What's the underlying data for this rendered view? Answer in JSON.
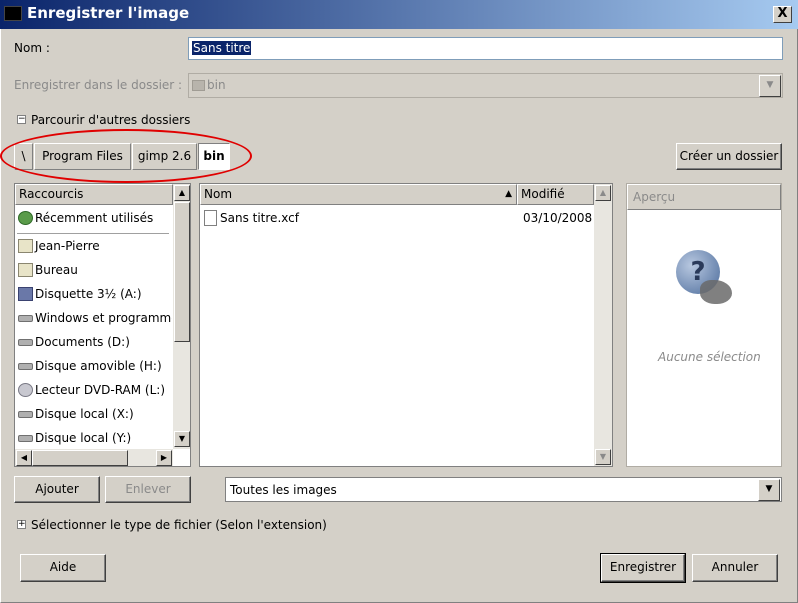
{
  "window": {
    "title": "Enregistrer l'image",
    "close_glyph": "X"
  },
  "name_field": {
    "label": "Nom :",
    "value": "Sans titre"
  },
  "save_in": {
    "label": "Enregistrer dans le dossier :",
    "value": "bin"
  },
  "browse": {
    "label": "Parcourir d'autres dossiers",
    "toggle": "−"
  },
  "path": {
    "buttons": [
      "\\",
      "Program Files",
      "gimp 2.6",
      "bin"
    ],
    "create_folder": "Créer un dossier"
  },
  "places": {
    "header": "Raccourcis",
    "items": [
      {
        "label": "Récemment utilisés",
        "icon": "recent-icon"
      },
      {
        "label": "Jean-Pierre",
        "icon": "folder-icon"
      },
      {
        "label": "Bureau",
        "icon": "folder-icon"
      },
      {
        "label": "Disquette 3½ (A:)",
        "icon": "floppy-icon"
      },
      {
        "label": "Windows et programmes (C:)",
        "icon": "drive-icon"
      },
      {
        "label": "Documents (D:)",
        "icon": "drive-icon"
      },
      {
        "label": "Disque amovible (H:)",
        "icon": "drive-icon"
      },
      {
        "label": "Lecteur DVD-RAM (L:)",
        "icon": "cdrom-icon"
      },
      {
        "label": "Disque local (X:)",
        "icon": "drive-icon"
      },
      {
        "label": "Disque local (Y:)",
        "icon": "drive-icon"
      }
    ],
    "add_label": "Ajouter",
    "remove_label": "Enlever"
  },
  "files": {
    "col_name": "Nom",
    "col_modified": "Modifié",
    "rows": [
      {
        "name": "Sans titre.xcf",
        "modified": "03/10/2008"
      }
    ]
  },
  "preview": {
    "header": "Aperçu",
    "empty": "Aucune sélection"
  },
  "filter": {
    "value": "Toutes les images"
  },
  "filetype": {
    "label": "Sélectionner le type de fichier (Selon l'extension)",
    "toggle": "+"
  },
  "buttons": {
    "help": "Aide",
    "save": "Enregistrer",
    "cancel": "Annuler"
  },
  "colors": {
    "accent_red": "#e00000",
    "title_blue": "#0a246a",
    "selection": "#0a246a"
  }
}
